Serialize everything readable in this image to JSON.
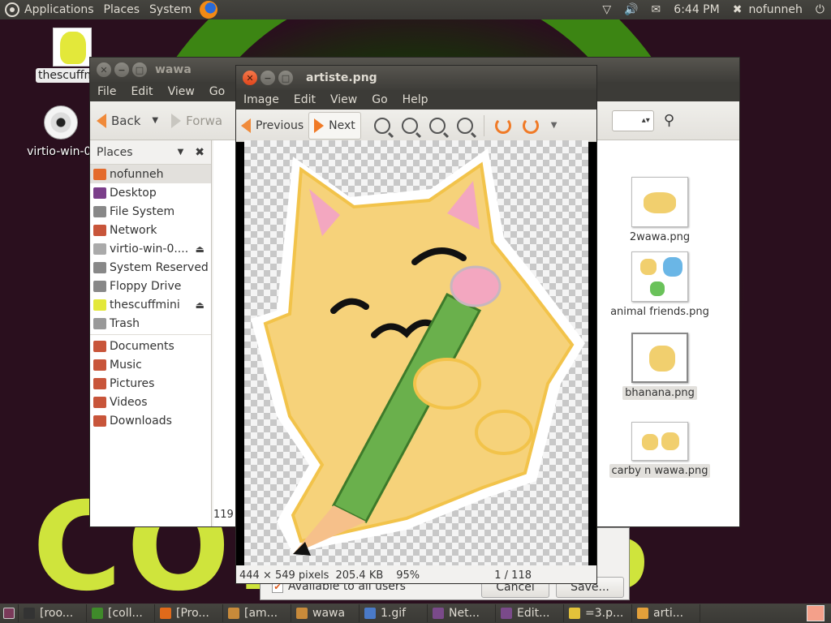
{
  "top_panel": {
    "menus": [
      "Applications",
      "Places",
      "System"
    ],
    "clock": "6:44 PM",
    "user": "nofunneh"
  },
  "desktop": {
    "icons": [
      {
        "label": "thescuffmini",
        "icon": "image-file-icon"
      },
      {
        "label": "virtio-win-0.",
        "icon": "cd-icon"
      }
    ],
    "wallpaper_text": "COL SOS"
  },
  "file_manager": {
    "title": "wawa",
    "menu": [
      "File",
      "Edit",
      "View",
      "Go",
      "Bo"
    ],
    "toolbar": {
      "back": "Back",
      "forward": "Forwa"
    },
    "sidebar_title": "Places",
    "places": [
      {
        "label": "nofunneh",
        "color": "#e46a2c"
      },
      {
        "label": "Desktop",
        "color": "#7b3f8a"
      },
      {
        "label": "File System",
        "color": "#888888"
      },
      {
        "label": "Network",
        "color": "#c8553a"
      },
      {
        "label": "virtio-win-0....",
        "color": "#aaaaaa"
      },
      {
        "label": "System Reserved",
        "color": "#888888"
      },
      {
        "label": "Floppy Drive",
        "color": "#888888"
      },
      {
        "label": "thescuffmini",
        "color": "#e3e83a"
      },
      {
        "label": "Trash",
        "color": "#999999"
      }
    ],
    "bookmarks": [
      {
        "label": "Documents",
        "color": "#c8553a"
      },
      {
        "label": "Music",
        "color": "#c8553a"
      },
      {
        "label": "Pictures",
        "color": "#c8553a"
      },
      {
        "label": "Videos",
        "color": "#c8553a"
      },
      {
        "label": "Downloads",
        "color": "#c8553a"
      }
    ],
    "files": [
      "2wawa.png",
      "animal friends.png",
      "bhanana.png",
      "carby n wawa.png"
    ],
    "status_partial": "119"
  },
  "image_viewer": {
    "title": "artiste.png",
    "menu": [
      "Image",
      "Edit",
      "View",
      "Go",
      "Help"
    ],
    "toolbar": {
      "previous": "Previous",
      "next": "Next"
    },
    "status": {
      "dimensions": "444 × 549 pixels",
      "size": "205.4 KB",
      "zoom": "95%",
      "position": "1 / 118"
    }
  },
  "dialog": {
    "checkbox_label": "Available to all users",
    "cancel": "Cancel",
    "save": "Save..."
  },
  "taskbar": {
    "items": [
      {
        "label": "[roo...",
        "color": "#333333"
      },
      {
        "label": "[coll...",
        "color": "#3f8a2a"
      },
      {
        "label": "[Pro...",
        "color": "#e06a1a"
      },
      {
        "label": "[am...",
        "color": "#c88a3a"
      },
      {
        "label": "wawa",
        "color": "#c88a3a"
      },
      {
        "label": "1.gif",
        "color": "#4a7ac8"
      },
      {
        "label": "Net...",
        "color": "#7a4a8a"
      },
      {
        "label": "Edit...",
        "color": "#7a4a8a"
      },
      {
        "label": "=3.p...",
        "color": "#e3c23a"
      },
      {
        "label": "arti...",
        "color": "#e3a03a"
      }
    ]
  },
  "colors": {
    "accent": "#f07a26",
    "panel": "#3c3b37"
  }
}
